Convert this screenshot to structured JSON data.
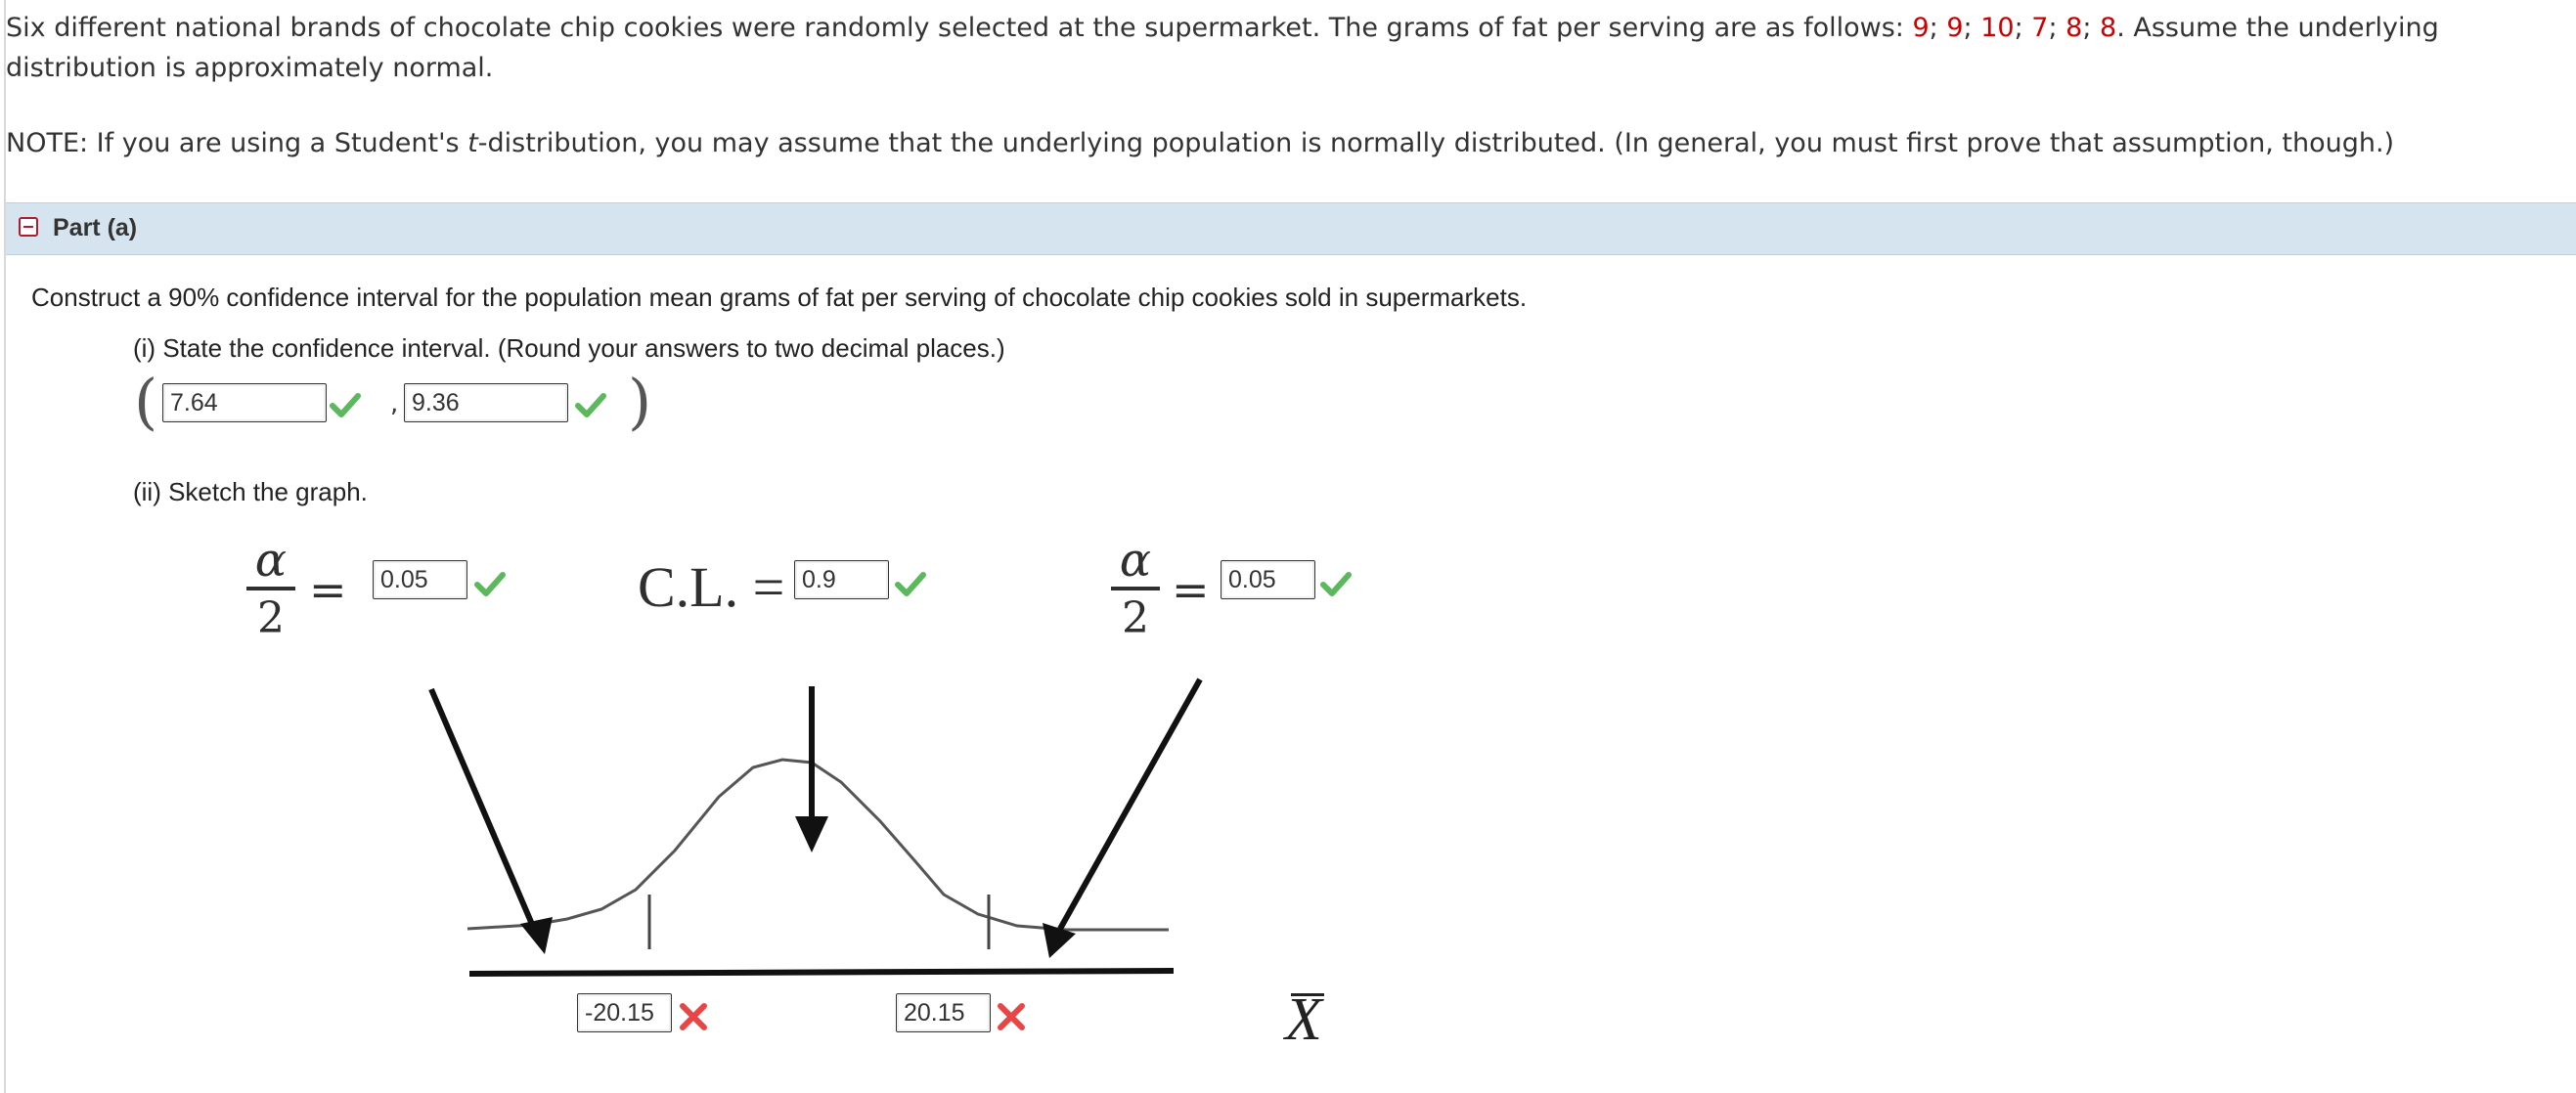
{
  "problem": {
    "intro_before": "Six different national brands of chocolate chip cookies were randomly selected at the supermarket. The grams of fat per serving are as follows: ",
    "values": [
      "9",
      "9",
      "10",
      "7",
      "8",
      "8"
    ],
    "separator": "; ",
    "intro_after": ". Assume the underlying distribution is approximately normal.",
    "note_before": "NOTE: If you are using a Student's ",
    "note_t": "t",
    "note_after": "-distribution, you may assume that the underlying population is normally distributed. (In general, you must first prove that assumption, though.)"
  },
  "part_a": {
    "header": "Part (a)",
    "prompt": "Construct a 90% confidence interval for the population mean grams of fat per serving of chocolate chip cookies sold in supermarkets.",
    "sub_i": "(i) State the confidence interval. (Round your answers to two decimal places.)",
    "lower": "7.64",
    "upper": "9.36",
    "comma": ",",
    "open_paren": "(",
    "close_paren": ")",
    "sub_ii": "(ii) Sketch the graph."
  },
  "graph": {
    "alpha_symbol": "α",
    "two": "2",
    "equals": "=",
    "cl_label": "C.L. =",
    "alpha_left": "0.05",
    "cl_value": "0.9",
    "alpha_right": "0.05",
    "x_left": "-20.15",
    "x_right": "20.15",
    "x_label": "X"
  },
  "status": {
    "correct_color": "#5cb85c",
    "incorrect_color": "#e84646",
    "number_color": "#cc0000"
  }
}
